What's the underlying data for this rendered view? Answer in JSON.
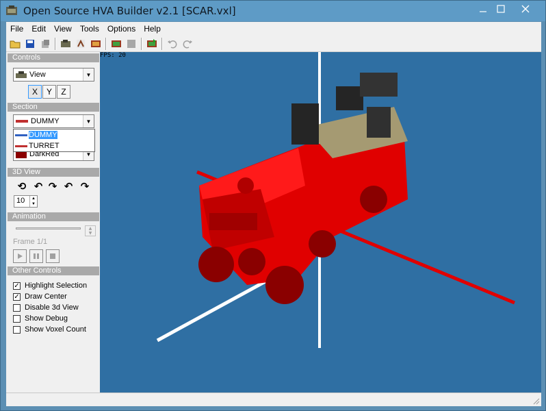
{
  "window": {
    "title": "Open Source HVA Builder v2.1 [SCAR.vxl]"
  },
  "menu": [
    "File",
    "Edit",
    "View",
    "Tools",
    "Options",
    "Help"
  ],
  "toolbar": {
    "buttons": [
      "open-icon",
      "save-icon",
      "save-as-icon",
      "voxel-icon",
      "hva-icon",
      "camera-icon",
      "render-icon",
      "disabled-icon",
      "export-icon",
      "undo-icon",
      "redo-icon"
    ]
  },
  "sidebar": {
    "controls_header": "Controls",
    "view_combo": "View",
    "axes": [
      "X",
      "Y",
      "Z"
    ],
    "section_header": "Section",
    "section_combo": "DUMMY",
    "section_options": [
      "DUMMY",
      "TURRET"
    ],
    "color_combo": "DarkRed",
    "view3d_header": "3D View",
    "spin_value": "10",
    "animation_header": "Animation",
    "frame_label": "Frame 1/1",
    "other_header": "Other Controls",
    "checkboxes": [
      {
        "label": "Highlight Selection",
        "checked": true
      },
      {
        "label": "Draw Center",
        "checked": true
      },
      {
        "label": "Disable 3d View",
        "checked": false
      },
      {
        "label": "Show Debug",
        "checked": false
      },
      {
        "label": "Show Voxel Count",
        "checked": false
      }
    ]
  },
  "viewport": {
    "fps": "FPS: 20",
    "background": "#2f6fa3"
  }
}
